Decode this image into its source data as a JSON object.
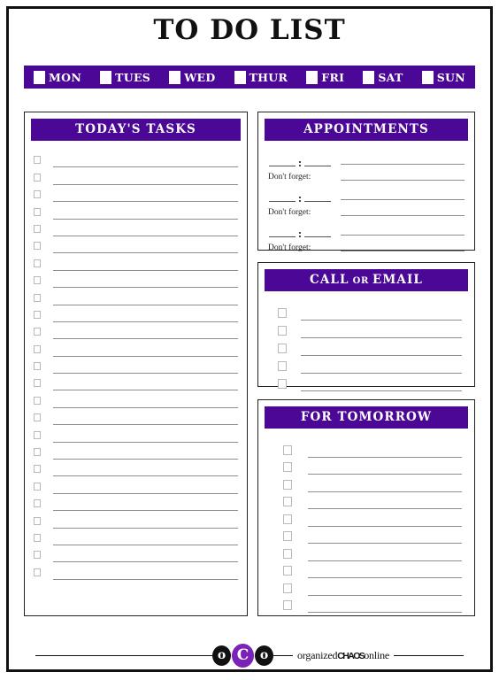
{
  "document": {
    "title": "TO DO LIST"
  },
  "colors": {
    "accent_purple": "#4B0896",
    "logo_purple": "#7B22B8",
    "border_black": "#111111",
    "rule_gray": "#8e8e8e"
  },
  "weekdays": {
    "items": [
      {
        "label": "MON"
      },
      {
        "label": "TUES"
      },
      {
        "label": "WED"
      },
      {
        "label": "THUR"
      },
      {
        "label": "FRI"
      },
      {
        "label": "SAT"
      },
      {
        "label": "SUN"
      }
    ]
  },
  "panels": {
    "tasks": {
      "header": "TODAY'S TASKS",
      "row_count": 25
    },
    "appointments": {
      "header": "APPOINTMENTS",
      "time_separator": ":",
      "forget_label": "Don't forget:",
      "group_count": 3
    },
    "call_or_email": {
      "header_part1": "CALL",
      "header_or": "OR",
      "header_part2": "EMAIL",
      "row_count": 5
    },
    "tomorrow": {
      "header": "FOR TOMORROW",
      "row_count": 10
    }
  },
  "footer": {
    "logo_left": "o",
    "logo_center": "C",
    "logo_right": "o",
    "brand_prefix": "organized",
    "brand_mid": "CHAOS",
    "brand_suffix": "online"
  }
}
